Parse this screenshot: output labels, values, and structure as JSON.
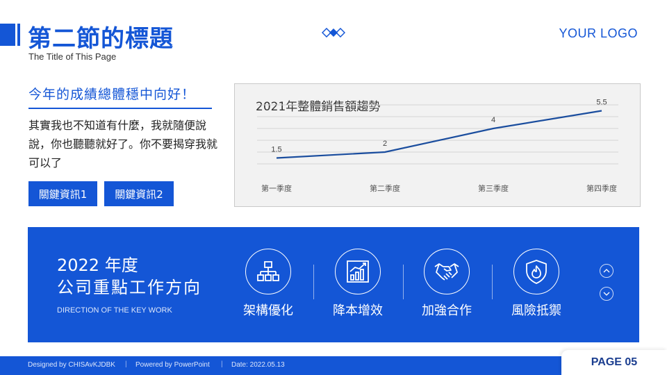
{
  "header": {
    "title": "第二節的標題",
    "subtitle": "The Title of This Page",
    "logo": "YOUR LOGO"
  },
  "intro": {
    "headline": "今年的成績總體穩中向好！",
    "body": "其實我也不知道有什麼，我就隨便說說，你也聽聽就好了。你不要揭穿我就可以了",
    "buttons": [
      "關鍵資訊1",
      "關鍵資訊2"
    ]
  },
  "chart_data": {
    "type": "line",
    "title": "2021年整體銷售額趨勢",
    "categories": [
      "第一季度",
      "第二季度",
      "第三季度",
      "第四季度"
    ],
    "series": [
      {
        "values": [
          1.5,
          2,
          4,
          5.5
        ]
      }
    ],
    "data_labels": [
      "1.5",
      "2",
      "4",
      "5.5"
    ],
    "ylim": [
      0,
      6
    ],
    "grid": true,
    "color": "#1a4d9e"
  },
  "panel": {
    "year": "2022 年度",
    "title": "公司重點工作方向",
    "subtitle": "DIRECTION OF THE KEY WORK",
    "features": [
      {
        "label": "架構優化",
        "icon": "org-chart-icon"
      },
      {
        "label": "降本增效",
        "icon": "bar-growth-icon"
      },
      {
        "label": "加強合作",
        "icon": "handshake-icon"
      },
      {
        "label": "風險抵禦",
        "icon": "shield-fire-icon"
      }
    ]
  },
  "footer": {
    "designed": "Designed by CHISAvKJDBK",
    "powered": "Powered by PowerPoint",
    "date": "Date: 2022.05.13",
    "page": "PAGE 05"
  },
  "colors": {
    "brand": "#1456d6",
    "line": "#1a4d9e",
    "page_text": "#1a3d8f"
  }
}
